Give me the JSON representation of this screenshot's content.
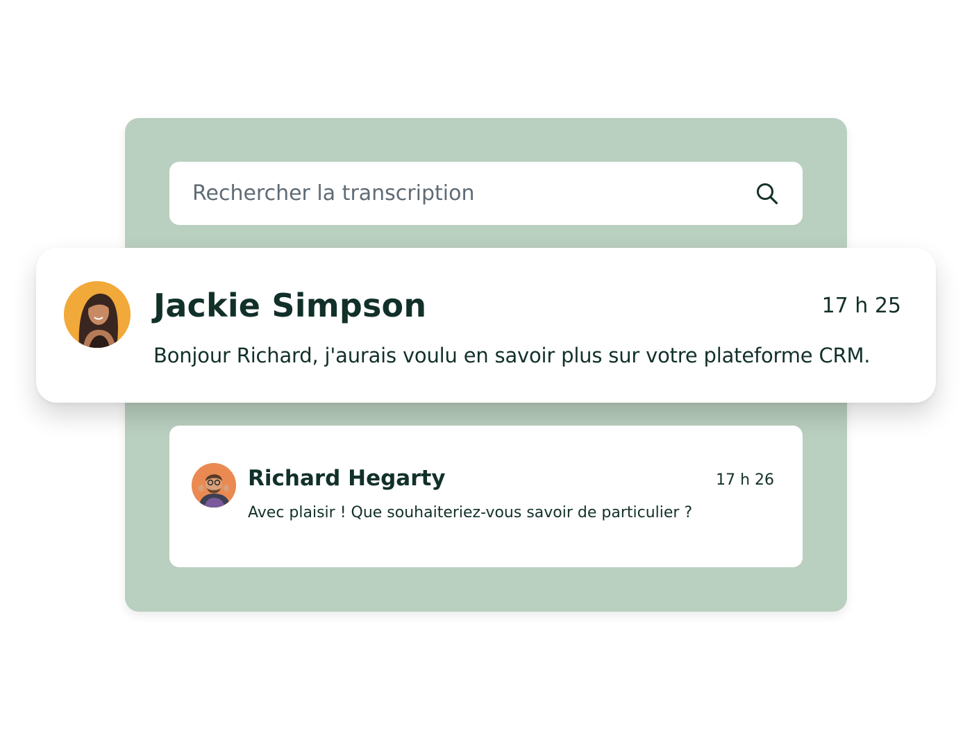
{
  "search": {
    "placeholder": "Rechercher la transcription",
    "icon": "search-icon"
  },
  "messages": [
    {
      "name": "Jackie Simpson",
      "time": "17 h 25",
      "text": "Bonjour Richard, j'aurais voulu en savoir plus sur votre plateforme CRM.",
      "avatar_bg": "#f1a93a"
    },
    {
      "name": "Richard Hegarty",
      "time": "17 h 26",
      "text": "Avec plaisir ! Que souhaiteriez-vous savoir de particulier ?",
      "avatar_bg": "#ea8a52"
    }
  ],
  "colors": {
    "panel": "#b9cfbf",
    "text": "#12302a"
  }
}
